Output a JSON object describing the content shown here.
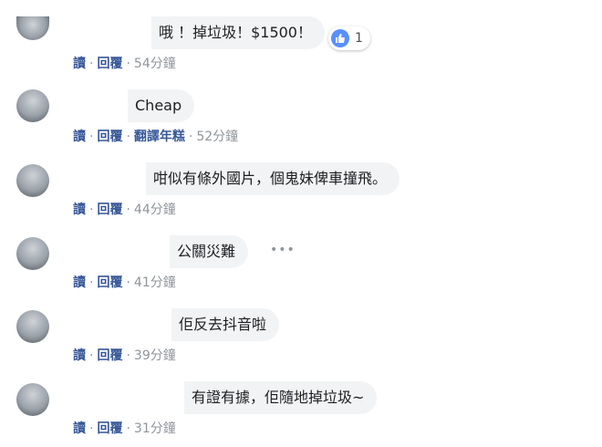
{
  "actions": {
    "read": "讀",
    "reply": "回覆",
    "translate": "翻譯年糕"
  },
  "separator": "·",
  "reaction": {
    "icon": "like-icon",
    "count": "1",
    "color": "#5890ff"
  },
  "more_icon": "more-horizontal-icon",
  "comments": [
    {
      "text": "哦 ！掉垃圾！$1500！",
      "time": "54分鐘"
    },
    {
      "text": "Cheap",
      "time": "52分鐘"
    },
    {
      "text": "咁似有條外國片，個鬼妹俾車撞飛。",
      "time": "44分鐘"
    },
    {
      "text": "公關災難",
      "time": "41分鐘"
    },
    {
      "text": "佢反去抖音啦",
      "time": "39分鐘"
    },
    {
      "text": "有證有據，佢隨地掉垃圾~",
      "time": "31分鐘"
    }
  ]
}
